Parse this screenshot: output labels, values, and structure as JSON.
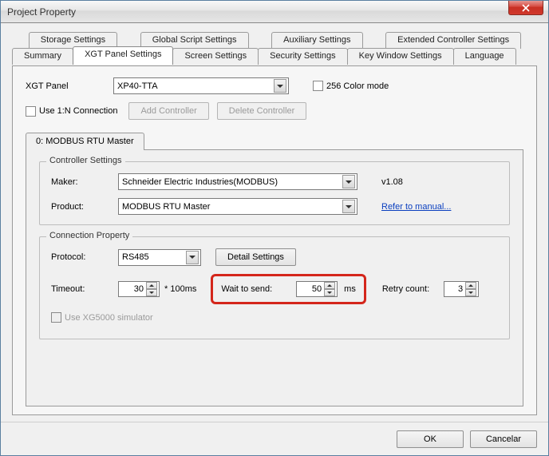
{
  "window": {
    "title": "Project Property"
  },
  "tabs_top": [
    "Storage Settings",
    "Global Script Settings",
    "Auxiliary Settings",
    "Extended Controller Settings"
  ],
  "tabs_bottom": [
    "Summary",
    "XGT Panel Settings",
    "Screen Settings",
    "Security Settings",
    "Key Window Settings",
    "Language"
  ],
  "active_tab_index": 1,
  "panel": {
    "xgt_label": "XGT Panel",
    "xgt_value": "XP40-TTA",
    "color_mode_label": "256 Color mode",
    "use_1n_label": "Use 1:N Connection",
    "add_controller": "Add Controller",
    "delete_controller": "Delete Controller"
  },
  "inner_tab": "0: MODBUS RTU Master",
  "controller": {
    "legend": "Controller Settings",
    "maker_label": "Maker:",
    "maker_value": "Schneider Electric Industries(MODBUS)",
    "product_label": "Product:",
    "product_value": "MODBUS RTU Master",
    "version": "v1.08",
    "manual_link": "Refer to manual..."
  },
  "connection": {
    "legend": "Connection Property",
    "protocol_label": "Protocol:",
    "protocol_value": "RS485",
    "detail_button": "Detail Settings",
    "timeout_label": "Timeout:",
    "timeout_value": "30",
    "timeout_unit": "* 100ms",
    "wait_label": "Wait to send:",
    "wait_value": "50",
    "wait_unit": "ms",
    "retry_label": "Retry count:",
    "retry_value": "3",
    "simulator_label": "Use XG5000 simulator"
  },
  "footer": {
    "ok": "OK",
    "cancel": "Cancelar"
  }
}
